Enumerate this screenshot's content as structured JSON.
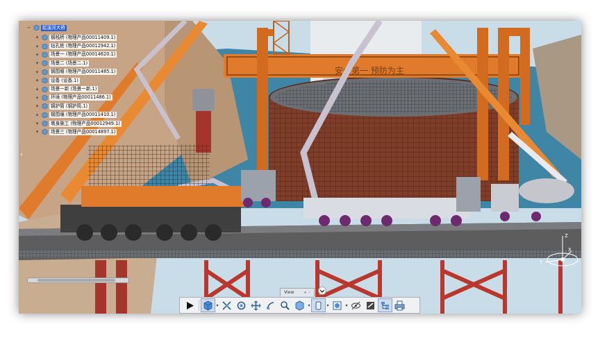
{
  "tree": {
    "root_label": "起溪河大桥",
    "items": [
      {
        "label": "钢栈桥 (物理产品00011409.1)"
      },
      {
        "label": "钻孔桩 (物理产品00012942.1)"
      },
      {
        "label": "场景一 (物理产品00014620.1)"
      },
      {
        "label": "场景二 (场景二.1)"
      },
      {
        "label": "钢围堰 (物理产品00011485.1)"
      },
      {
        "label": "设备 (设备.1)"
      },
      {
        "label": "场景一新 (场景一新.1)"
      },
      {
        "label": "环境 (物理产品00011486.1)"
      },
      {
        "label": "钢护筒 (钢护筒.1)"
      },
      {
        "label": "钢围壤 (物理产品00011410.1)"
      },
      {
        "label": "墩身施工 (物理产品00012949.1)"
      },
      {
        "label": "场景三 (物理产品00014897.1)"
      }
    ]
  },
  "scene": {
    "banner_text": "安全第一 预防为主",
    "colors": {
      "sky": "#c9dde8",
      "water": "#3f86a6",
      "orange": "#e07b2b",
      "steel_red": "#a5342c",
      "cofferdam": "#7a3b27",
      "deck": "#5d5d5d"
    }
  },
  "view_tab": {
    "label": "View",
    "dots": "• ◦"
  },
  "toolbar": {
    "buttons": [
      {
        "name": "play-icon"
      },
      {
        "name": "view-cube-icon"
      },
      {
        "name": "fit-all-icon"
      },
      {
        "name": "rotate-icon"
      },
      {
        "name": "pan-icon"
      },
      {
        "name": "fly-icon"
      },
      {
        "name": "zoom-icon"
      },
      {
        "name": "view-mode-icon"
      },
      {
        "name": "parallel-projection-icon"
      },
      {
        "name": "render-style-icon"
      },
      {
        "name": "hide-show-icon"
      },
      {
        "name": "swap-visible-icon"
      },
      {
        "name": "tree-toggle-icon"
      },
      {
        "name": "print-icon"
      }
    ]
  },
  "compass": {
    "axis_x": "X",
    "axis_y": "Y",
    "axis_z": "Z"
  }
}
